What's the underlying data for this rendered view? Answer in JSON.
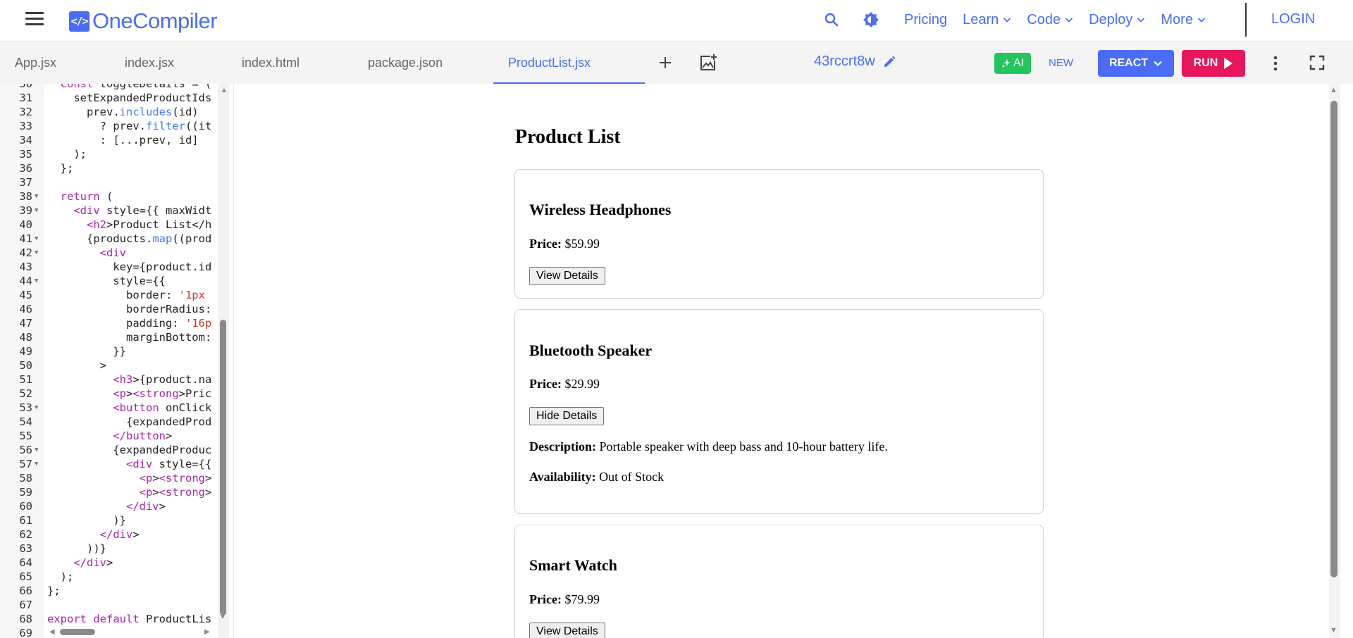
{
  "brand": {
    "logo_glyph": "</>",
    "name": "OneCompiler",
    "color": "#4a6cf7"
  },
  "nav": {
    "links": [
      {
        "label": "Pricing",
        "has_dropdown": false
      },
      {
        "label": "Learn",
        "has_dropdown": true
      },
      {
        "label": "Code",
        "has_dropdown": true
      },
      {
        "label": "Deploy",
        "has_dropdown": true
      },
      {
        "label": "More",
        "has_dropdown": true
      }
    ],
    "login": "LOGIN",
    "icons": [
      "menu-icon",
      "search-icon",
      "theme-toggle-icon"
    ]
  },
  "tabs": {
    "files": [
      "App.jsx",
      "index.jsx",
      "index.html",
      "package.json",
      "ProductList.jsx"
    ],
    "active": "ProductList.jsx",
    "project_name": "43rccrt8w",
    "ai_label": "AI",
    "new_label": "NEW",
    "language_label": "REACT",
    "run_label": "RUN",
    "colors": {
      "ai": "#22c55e",
      "react": "#4a6cf7",
      "run": "#e8175d"
    }
  },
  "editor": {
    "lines": [
      {
        "n": "30",
        "fold": false,
        "code": "  const toggleDetails = ("
      },
      {
        "n": "31",
        "fold": false,
        "code": "    setExpandedProductIds"
      },
      {
        "n": "32",
        "fold": false,
        "code": "      prev.includes(id)"
      },
      {
        "n": "33",
        "fold": false,
        "code": "        ? prev.filter((it"
      },
      {
        "n": "34",
        "fold": false,
        "code": "        : [...prev, id]"
      },
      {
        "n": "35",
        "fold": false,
        "code": "    );"
      },
      {
        "n": "36",
        "fold": false,
        "code": "  };"
      },
      {
        "n": "37",
        "fold": false,
        "code": ""
      },
      {
        "n": "38",
        "fold": true,
        "code": "  return ("
      },
      {
        "n": "39",
        "fold": true,
        "code": "    <div style={{ maxWidt"
      },
      {
        "n": "40",
        "fold": false,
        "code": "      <h2>Product List</h"
      },
      {
        "n": "41",
        "fold": true,
        "code": "      {products.map((prod"
      },
      {
        "n": "42",
        "fold": true,
        "code": "        <div"
      },
      {
        "n": "43",
        "fold": false,
        "code": "          key={product.id"
      },
      {
        "n": "44",
        "fold": true,
        "code": "          style={{"
      },
      {
        "n": "45",
        "fold": false,
        "code": "            border: '1px"
      },
      {
        "n": "46",
        "fold": false,
        "code": "            borderRadius:"
      },
      {
        "n": "47",
        "fold": false,
        "code": "            padding: '16p"
      },
      {
        "n": "48",
        "fold": false,
        "code": "            marginBottom:"
      },
      {
        "n": "49",
        "fold": false,
        "code": "          }}"
      },
      {
        "n": "50",
        "fold": false,
        "code": "        >"
      },
      {
        "n": "51",
        "fold": false,
        "code": "          <h3>{product.na"
      },
      {
        "n": "52",
        "fold": false,
        "code": "          <p><strong>Pric"
      },
      {
        "n": "53",
        "fold": true,
        "code": "          <button onClick"
      },
      {
        "n": "54",
        "fold": false,
        "code": "            {expandedProd"
      },
      {
        "n": "55",
        "fold": false,
        "code": "          </button>"
      },
      {
        "n": "56",
        "fold": true,
        "code": "          {expandedProduc"
      },
      {
        "n": "57",
        "fold": true,
        "code": "            <div style={{"
      },
      {
        "n": "58",
        "fold": false,
        "code": "              <p><strong>"
      },
      {
        "n": "59",
        "fold": false,
        "code": "              <p><strong>"
      },
      {
        "n": "60",
        "fold": false,
        "code": "            </div>"
      },
      {
        "n": "61",
        "fold": false,
        "code": "          )}"
      },
      {
        "n": "62",
        "fold": false,
        "code": "        </div>"
      },
      {
        "n": "63",
        "fold": false,
        "code": "      ))}"
      },
      {
        "n": "64",
        "fold": false,
        "code": "    </div>"
      },
      {
        "n": "65",
        "fold": false,
        "code": "  );"
      },
      {
        "n": "66",
        "fold": false,
        "code": "};"
      },
      {
        "n": "67",
        "fold": false,
        "code": ""
      },
      {
        "n": "68",
        "fold": false,
        "code": "export default ProductLis"
      },
      {
        "n": "69",
        "fold": false,
        "code": ""
      }
    ]
  },
  "preview": {
    "title": "Product List",
    "products": [
      {
        "name": "Wireless Headphones",
        "price_label": "Price:",
        "price": "$59.99",
        "button": "View Details",
        "expanded": false
      },
      {
        "name": "Bluetooth Speaker",
        "price_label": "Price:",
        "price": "$29.99",
        "button": "Hide Details",
        "expanded": true,
        "desc_label": "Description:",
        "description": "Portable speaker with deep bass and 10-hour battery life.",
        "avail_label": "Availability:",
        "availability": "Out of Stock"
      },
      {
        "name": "Smart Watch",
        "price_label": "Price:",
        "price": "$79.99",
        "button": "View Details",
        "expanded": false
      }
    ]
  }
}
